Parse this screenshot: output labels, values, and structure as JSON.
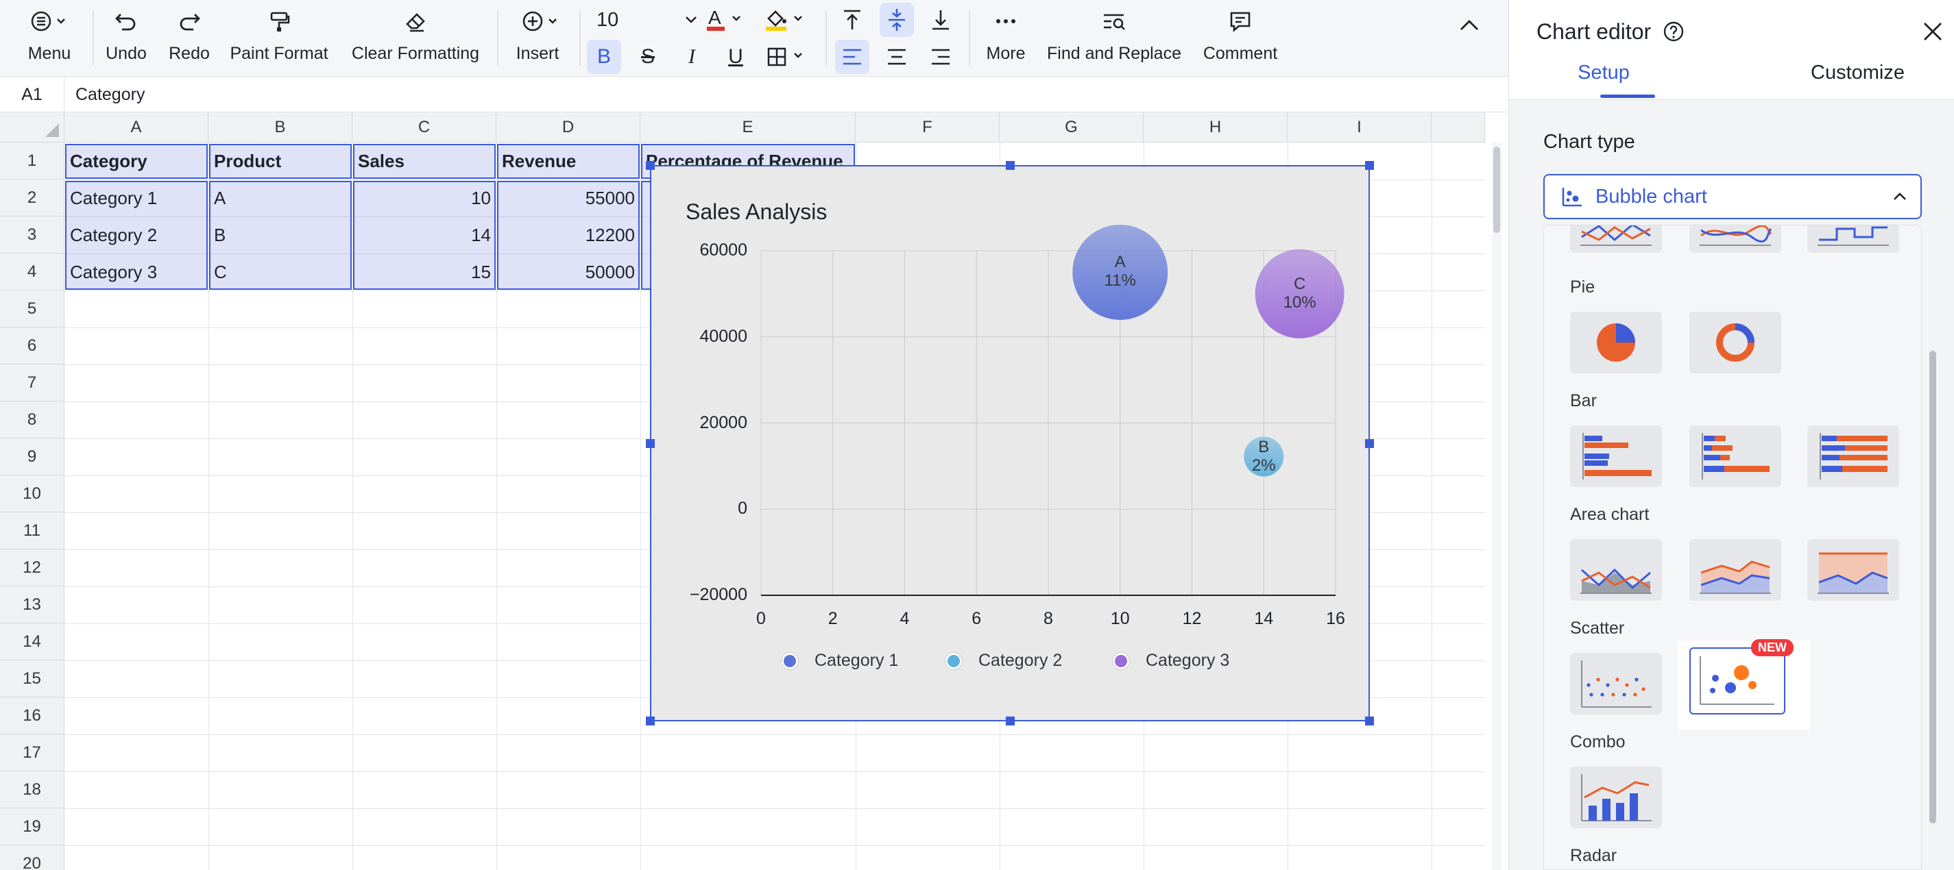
{
  "toolbar": {
    "menu": "Menu",
    "undo": "Undo",
    "redo": "Redo",
    "paint_format": "Paint Format",
    "clear_formatting": "Clear Formatting",
    "insert": "Insert",
    "font_size": "10",
    "more": "More",
    "find_replace": "Find and Replace",
    "comment": "Comment",
    "bold_glyph": "B",
    "italic_glyph": "I",
    "underline_glyph": "U",
    "strike_glyph": "S"
  },
  "formula_bar": {
    "cell_ref": "A1",
    "value": "Category"
  },
  "sheet": {
    "columns": [
      "A",
      "B",
      "C",
      "D",
      "E",
      "F",
      "G",
      "H",
      "I"
    ],
    "rows": [
      "1",
      "2",
      "3",
      "4",
      "5",
      "6",
      "7",
      "8",
      "9",
      "10",
      "11",
      "12",
      "13",
      "14",
      "15",
      "16",
      "17",
      "18",
      "19",
      "20"
    ],
    "headers": [
      "Category",
      "Product",
      "Sales",
      "Revenue",
      "Percentage of Revenue"
    ],
    "data": [
      [
        "Category 1",
        "A",
        "10",
        "55000"
      ],
      [
        "Category 2",
        "B",
        "14",
        "12200"
      ],
      [
        "Category 3",
        "C",
        "15",
        "50000"
      ]
    ]
  },
  "chart_data": {
    "type": "scatter",
    "subtype": "bubble",
    "title": "Sales Analysis",
    "xlabel": "",
    "ylabel": "",
    "xlim": [
      0,
      16
    ],
    "ylim": [
      -20000,
      60000
    ],
    "x_ticks": [
      "0",
      "2",
      "4",
      "6",
      "8",
      "10",
      "12",
      "14",
      "16"
    ],
    "y_ticks": [
      "60000",
      "40000",
      "20000",
      "0",
      "−20000"
    ],
    "grid": true,
    "legend_position": "bottom",
    "series": [
      {
        "name": "Category 1",
        "color": "#5b73d6",
        "points": [
          {
            "x": 10,
            "y": 55000,
            "label": "A",
            "pct": "11%"
          }
        ]
      },
      {
        "name": "Category 2",
        "color": "#5fb0dc",
        "points": [
          {
            "x": 14,
            "y": 12200,
            "label": "B",
            "pct": "2%"
          }
        ]
      },
      {
        "name": "Category 3",
        "color": "#9b6ad9",
        "points": [
          {
            "x": 15,
            "y": 50000,
            "label": "C",
            "pct": "10%"
          }
        ]
      }
    ]
  },
  "panel": {
    "title": "Chart editor",
    "tabs": [
      "Setup",
      "Customize"
    ],
    "chart_type_label": "Chart type",
    "selected_type": "Bubble chart",
    "groups": {
      "pie": "Pie",
      "bar": "Bar",
      "area": "Area chart",
      "scatter": "Scatter",
      "combo": "Combo",
      "radar": "Radar"
    },
    "new_badge": "NEW",
    "colors": {
      "accent": "#3a5bd9",
      "orange": "#e8602c",
      "blue": "#3d5bd6"
    }
  }
}
